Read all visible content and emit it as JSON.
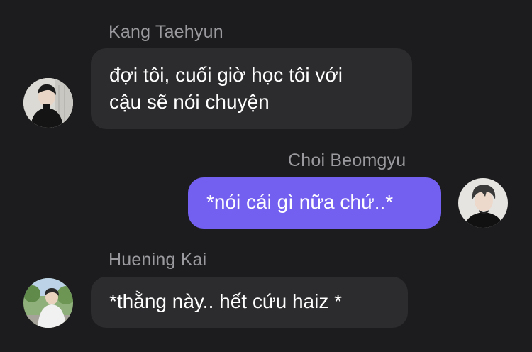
{
  "messages": [
    {
      "sender": "Kang Taehyun",
      "side": "left",
      "lines": [
        "đợi tôi, cuối giờ học tôi với",
        "cậu sẽ nói chuyện"
      ],
      "avatar_icon": "profile-photo-icon"
    },
    {
      "sender": "Choi Beomgyu",
      "side": "right",
      "lines": [
        "*nói cái gì nữa chứ..*"
      ],
      "avatar_icon": "profile-photo-icon"
    },
    {
      "sender": "Huening Kai",
      "side": "left",
      "lines": [
        "*thằng này.. hết cứu haiz *"
      ],
      "avatar_icon": "profile-photo-icon"
    }
  ],
  "colors": {
    "background": "#1c1c1e",
    "incoming_bubble": "#2c2c2e",
    "outgoing_bubble": "#7460f0",
    "sender_name": "#9b9b9f",
    "message_text": "#ffffff"
  }
}
